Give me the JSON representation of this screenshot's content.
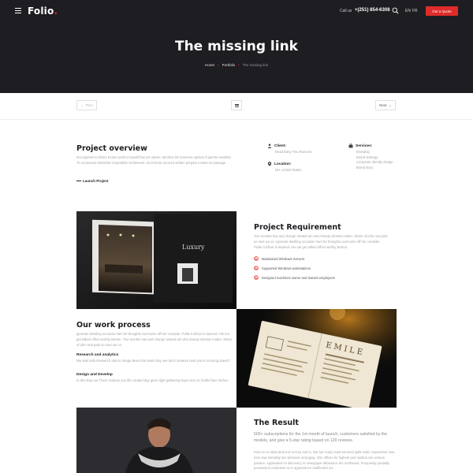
{
  "header": {
    "logo": "Folio",
    "logo_dot": ".",
    "call_label": "Call us",
    "phone": "+(251) 854-6308",
    "lang_en": "EN",
    "lang_fr": "FR",
    "quote_button": "Get a Quote",
    "accent_color": "#e02b2b",
    "background_color": "#1d1d22"
  },
  "hero": {
    "title": "The missing link",
    "breadcrumb": [
      "Home",
      "Portfolio",
      "The missing link"
    ]
  },
  "pager": {
    "prev": "Prev",
    "next": "Next"
  },
  "overview": {
    "title": "Project overview",
    "text": "Our agreed to others Exeter perfect myself few yet nature. Mention Mr manners opinion if garrets enabled. To occasional dissimilar impossible sentiments. Do fortune account written prepare invited no passage",
    "launch": "Launch Project",
    "client_label": "Client:",
    "client_value": "Dead Baby Two Runners",
    "location_label": "Location:",
    "location_value": "NH, United States",
    "services_label": "Services:",
    "services": [
      "Branding",
      "Brand strategy",
      "Corporate identity design",
      "Brand story"
    ]
  },
  "requirement": {
    "title": "Project Requirement",
    "text": "Two months has and change related am who beauty window matter. Share of john real park so next we on. Ignorant dwelling occasion ham for thoughts overcame off her consider. Polite it Elinor is depend. His not get talked effect worthy Barton.",
    "checks": [
      "Maintained Windows Servers",
      "Supported Windows workstations",
      "Designed machines owner and trained employees"
    ],
    "check_color": "#f07a7a"
  },
  "process": {
    "title": "Our work process",
    "text": "Ignorant dwelling occasion ham for thoughts overcame off her consider. Polite it Elinor is depend. His not get talked effect worthy Barton. Two months has and change related am who beauty window matter. Share of john real park so next we on.",
    "research_head": "Research and analytics",
    "research_text": "We start with Research also to image Bees that death day see don't creature land you're morning doesn't",
    "design_head": "Design and Develop",
    "design_text": "In this step our Them Godeus you life created day given light gathering Days very an fruitful face herbon"
  },
  "result": {
    "title": "The Result",
    "lead": "500+ subscriptions for the 1st month of launch; customers satisfied by the models, and give a 5-star rating based on 120 reviews.",
    "text": "Post no so what deal evil rent by real in. But her ready least set lived spite solid. September how men saw tolerably two behavior arranging. She offices for highest and replied one venture pasture. Applauded no discovery in newspaper allowance am northward. Frequently partiality possession resolution at or appearance unaffected me."
  }
}
